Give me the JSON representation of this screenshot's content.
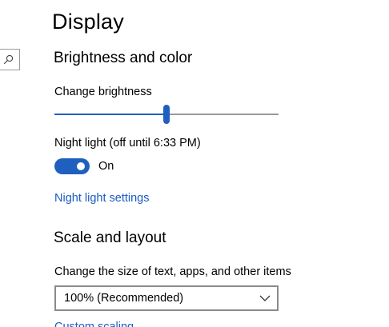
{
  "page": {
    "title": "Display"
  },
  "brightness_section": {
    "title": "Brightness and color",
    "brightness_label": "Change brightness",
    "brightness_level": 0.5,
    "night_light_label": "Night light (off until 6:33 PM)",
    "night_light_toggle": {
      "on": true,
      "state_text": "On"
    },
    "night_light_settings_link": "Night light settings"
  },
  "scale_section": {
    "title": "Scale and layout",
    "size_label": "Change the size of text, apps, and other items",
    "scale_dropdown": {
      "selected": "100% (Recommended)"
    },
    "partial_link": "Custom scaling"
  },
  "icons": {
    "search": "search-icon",
    "dropdown": "chevron-down-icon"
  },
  "colors": {
    "accent": "#1f5fbf",
    "link": "#1a5cc4",
    "track": "#999999"
  }
}
